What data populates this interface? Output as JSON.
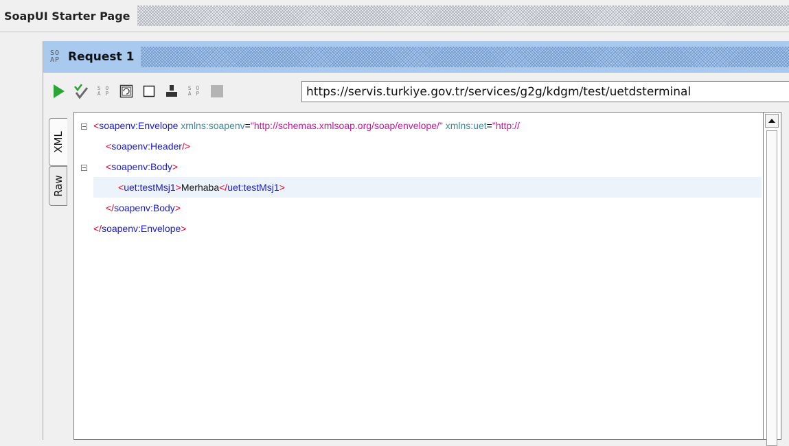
{
  "starter_page": {
    "title": "SoapUI Starter Page"
  },
  "request": {
    "icon_top": "SO",
    "icon_bottom": "AP",
    "title": "Request 1"
  },
  "toolbar": {
    "icons": [
      "run-icon",
      "validate-icon",
      "soap-icon",
      "format-icon",
      "checkbox-icon",
      "user-icon",
      "soap-icon",
      "stop-icon"
    ],
    "endpoint": "https://servis.turkiye.gov.tr/services/g2g/kdgm/test/uetdsterminal",
    "colors": {
      "run": "#2aa636",
      "header_bg": "#a9c9ee"
    }
  },
  "tabs": {
    "xml": "XML",
    "raw": "Raw"
  },
  "editor": {
    "env_open_bracket": "<",
    "env_tag": "soapenv:Envelope",
    "attr1_name": "xmlns:soapenv",
    "attr_eq": "=",
    "attr1_value": "\"http://schemas.xmlsoap.org/soap/envelope/\"",
    "attr2_name": "xmlns:uet",
    "attr2_value": "\"http://",
    "open_bracket": "<",
    "close_bracket": ">",
    "selfclose_end": "/>",
    "end_open": "</",
    "header_tag": "soapenv:Header",
    "body_tag": "soapenv:Body",
    "msg_tag": "uet:testMsj1",
    "msg_text": "Merhaba",
    "envelope_tag": "soapenv:Envelope"
  }
}
